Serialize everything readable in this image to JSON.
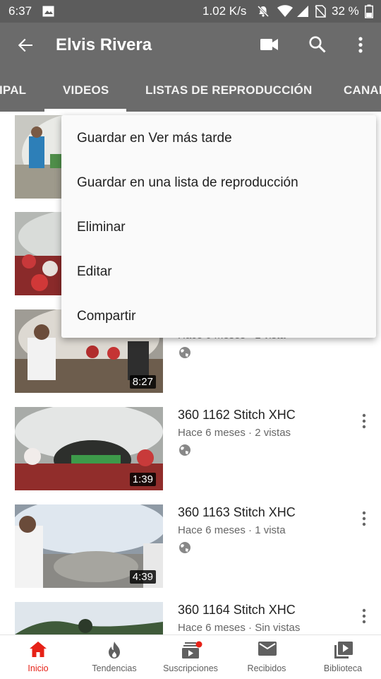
{
  "status_bar": {
    "time": "6:37",
    "speed": "1.02 K/s",
    "battery": "32 %",
    "icons": [
      "image-icon",
      "mute-icon",
      "wifi-icon",
      "signal-icon",
      "no-sim-icon",
      "battery-icon"
    ]
  },
  "app_bar": {
    "title": "Elvis Rivera",
    "icons": [
      "back-arrow-icon",
      "video-camera-icon",
      "search-icon",
      "more-vert-icon"
    ]
  },
  "tabs": [
    {
      "label": "IPAL"
    },
    {
      "label": "VIDEOS",
      "selected": true
    },
    {
      "label": "LISTAS DE REPRODUCCIÓN"
    },
    {
      "label": "CANAL"
    }
  ],
  "menu": {
    "items": [
      {
        "label": "Guardar en Ver más tarde"
      },
      {
        "label": "Guardar en una lista de reproducción"
      },
      {
        "label": "Eliminar"
      },
      {
        "label": "Editar"
      },
      {
        "label": "Compartir"
      }
    ]
  },
  "videos": [
    {
      "title": "",
      "meta": "",
      "duration": ""
    },
    {
      "title": "",
      "meta": "",
      "duration": ""
    },
    {
      "title": "",
      "meta": "Hace 6 meses · 1 vista",
      "duration": "8:27"
    },
    {
      "title": "360 1162 Stitch XHC",
      "meta": "Hace 6 meses · 2 vistas",
      "duration": "1:39"
    },
    {
      "title": "360 1163 Stitch XHC",
      "meta": "Hace 6 meses · 1 vista",
      "duration": "4:39"
    },
    {
      "title": "360 1164 Stitch XHC",
      "meta": "Hace 6 meses · Sin vistas",
      "duration": ""
    }
  ],
  "bottom_nav": [
    {
      "label": "Inicio",
      "icon": "home-icon",
      "active": true
    },
    {
      "label": "Tendencias",
      "icon": "flame-icon"
    },
    {
      "label": "Suscripciones",
      "icon": "subscriptions-icon",
      "badge": true
    },
    {
      "label": "Recibidos",
      "icon": "mail-icon"
    },
    {
      "label": "Biblioteca",
      "icon": "library-icon"
    }
  ],
  "colors": {
    "app_bar": "#6b6b6b",
    "status_bar": "#5c5c5c",
    "accent_red": "#e62117",
    "tab_indicator": "#ffffff"
  }
}
